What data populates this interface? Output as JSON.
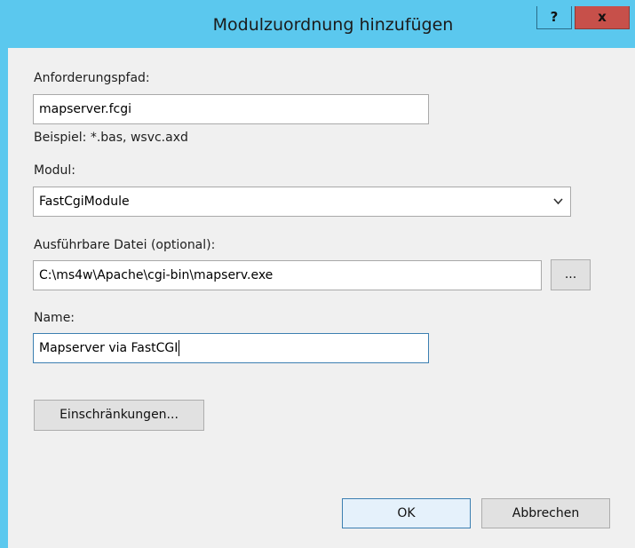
{
  "window": {
    "title": "Modulzuordnung hinzufügen",
    "help_label": "?",
    "close_label": "x"
  },
  "form": {
    "request_path": {
      "label": "Anforderungspfad:",
      "value": "mapserver.fcgi",
      "example": "Beispiel: *.bas, wsvc.axd"
    },
    "module": {
      "label": "Modul:",
      "selected": "FastCgiModule",
      "arrow_icon": "chevron-down-icon"
    },
    "executable": {
      "label": "Ausführbare Datei (optional):",
      "value": "C:\\ms4w\\Apache\\cgi-bin\\mapserv.exe",
      "browse_label": "..."
    },
    "name": {
      "label": "Name:",
      "value": "Mapserver via FastCGI"
    },
    "restrictions_label": "Einschränkungen..."
  },
  "buttons": {
    "ok": "OK",
    "cancel": "Abbrechen"
  }
}
